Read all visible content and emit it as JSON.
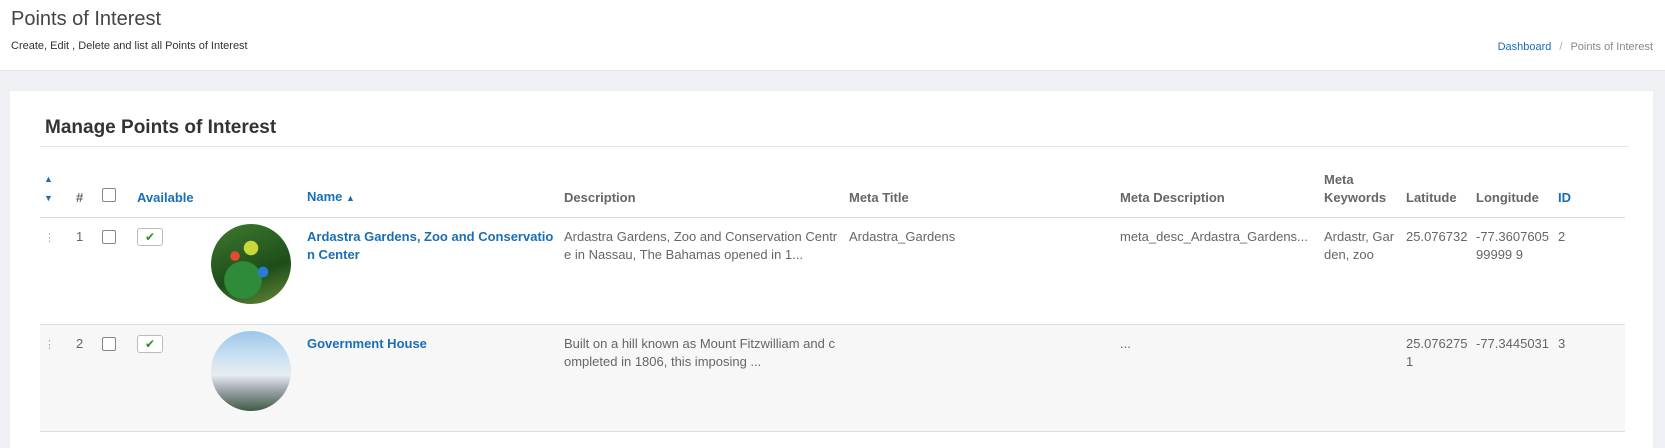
{
  "page": {
    "title": "Points of Interest",
    "subtitle": "Create, Edit , Delete and list all Points of Interest"
  },
  "breadcrumb": {
    "home": "Dashboard",
    "separator": "/",
    "current": "Points of Interest"
  },
  "card": {
    "title": "Manage Points of Interest"
  },
  "table": {
    "headers": {
      "num": "#",
      "available": "Available",
      "name": "Name",
      "description": "Description",
      "meta_title": "Meta Title",
      "meta_description": "Meta Description",
      "meta_keywords": "Meta Keywords",
      "latitude": "Latitude",
      "longitude": "Longitude",
      "id": "ID"
    },
    "rows": [
      {
        "num": "1",
        "available": true,
        "name": "Ardastra Gardens, Zoo and Conservation Center",
        "description": "Ardastra Gardens, Zoo and Conservation Centre in Nassau, The Bahamas opened in 1...",
        "meta_title": "Ardastra_Gardens",
        "meta_description": "meta_desc_Ardastra_Gardens...",
        "meta_keywords": "Ardastr, Garden, zoo",
        "latitude": "25.076732",
        "longitude": "-77.360760599999 9",
        "id": "2"
      },
      {
        "num": "2",
        "available": true,
        "name": "Government House",
        "description": "Built on a hill known as Mount Fitzwilliam and completed in 1806, this imposing ...",
        "meta_title": "",
        "meta_description": "...",
        "meta_keywords": "",
        "latitude": "25.0762751",
        "longitude": "-77.3445031",
        "id": "3"
      }
    ]
  },
  "colors": {
    "link": "#1a6eb5",
    "check": "#2e8b2e"
  },
  "icons": {
    "drag": "drag-handle-icon",
    "sort_asc": "sort-ascending-icon",
    "sort_both": "sort-icon",
    "check": "check-icon"
  }
}
